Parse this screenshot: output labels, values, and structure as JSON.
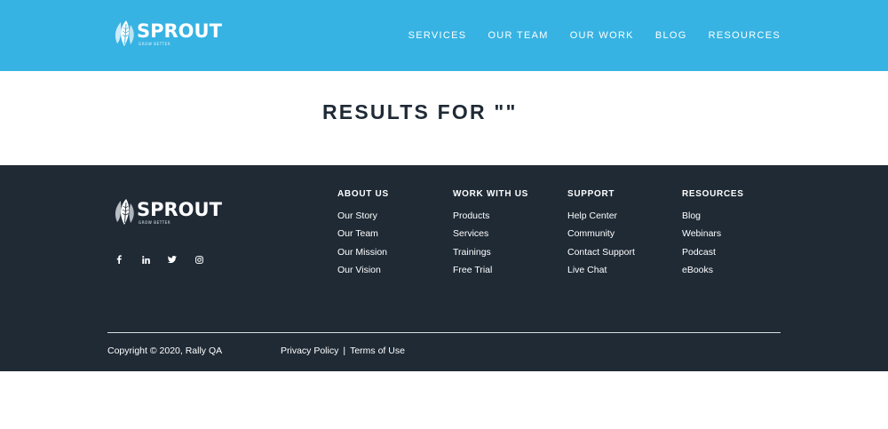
{
  "header": {
    "logo": {
      "name": "SPROUT",
      "tagline": "GROW BETTER"
    },
    "nav": [
      "SERVICES",
      "OUR TEAM",
      "OUR WORK",
      "BLOG",
      "RESOURCES"
    ],
    "bg_color": "#37b3e3"
  },
  "results": {
    "heading": "RESULTS FOR \"\""
  },
  "footer": {
    "logo": {
      "name": "SPROUT",
      "tagline": "GROW BETTER"
    },
    "social": [
      "facebook-icon",
      "linkedin-icon",
      "twitter-icon",
      "instagram-icon"
    ],
    "columns": [
      {
        "title": "ABOUT US",
        "links": [
          "Our Story",
          "Our Team",
          "Our Mission",
          "Our Vision"
        ]
      },
      {
        "title": "WORK WITH US",
        "links": [
          "Products",
          "Services",
          "Trainings",
          "Free Trial"
        ]
      },
      {
        "title": "SUPPORT",
        "links": [
          "Help Center",
          "Community",
          "Contact Support",
          "Live Chat"
        ]
      },
      {
        "title": "RESOURCES",
        "links": [
          "Blog",
          "Webinars",
          "Podcast",
          "eBooks"
        ]
      }
    ],
    "copyright": "Copyright © 2020, Rally QA",
    "legal": {
      "privacy": "Privacy Policy",
      "separator": "|",
      "terms": "Terms of Use"
    },
    "bg_color": "#1f2a35"
  }
}
